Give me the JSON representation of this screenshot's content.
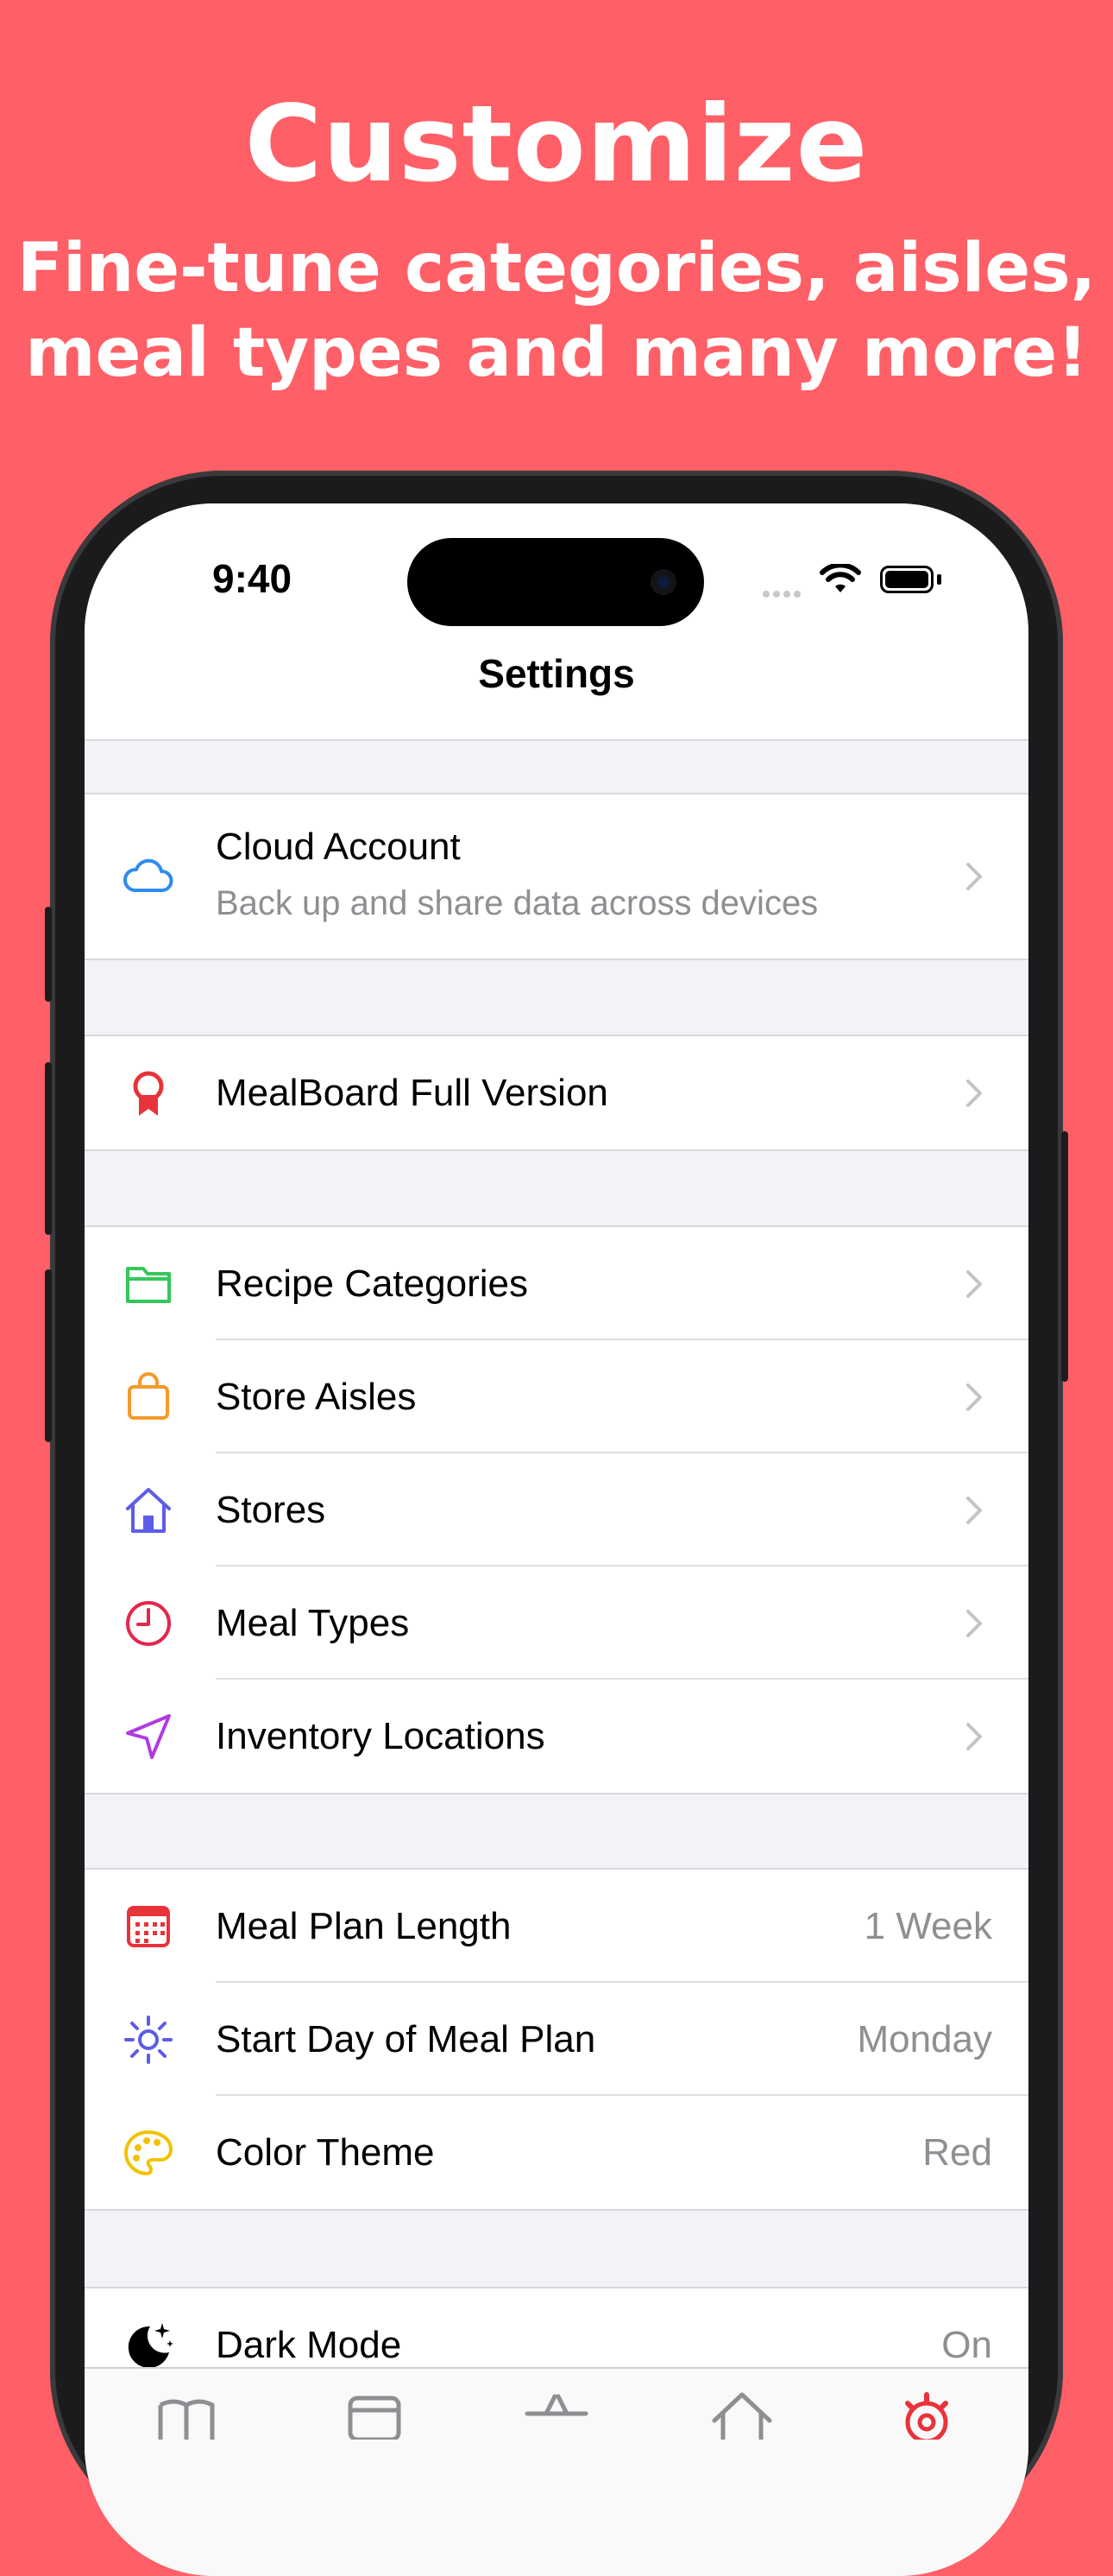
{
  "promo": {
    "headline": "Customize",
    "subhead_line1": "Fine-tune categories, aisles,",
    "subhead_line2": "meal types and many more!"
  },
  "status_bar": {
    "time": "9:40"
  },
  "nav": {
    "title": "Settings"
  },
  "sections": {
    "account": {
      "cloud": {
        "label": "Cloud Account",
        "subtitle": "Back up and share data across devices",
        "icon": "cloud-icon"
      }
    },
    "upgrade": {
      "full_version": {
        "label": "MealBoard Full Version",
        "icon": "ribbon-icon"
      }
    },
    "customize": {
      "recipe_categories": {
        "label": "Recipe Categories",
        "icon": "folder-icon"
      },
      "store_aisles": {
        "label": "Store Aisles",
        "icon": "bag-icon"
      },
      "stores": {
        "label": "Stores",
        "icon": "house-icon"
      },
      "meal_types": {
        "label": "Meal Types",
        "icon": "clock-icon"
      },
      "inventory_locations": {
        "label": "Inventory Locations",
        "icon": "location-arrow-icon"
      }
    },
    "plan": {
      "meal_plan_length": {
        "label": "Meal Plan Length",
        "value": "1 Week",
        "icon": "calendar-icon"
      },
      "start_day": {
        "label": "Start Day of Meal Plan",
        "value": "Monday",
        "icon": "sun-icon"
      },
      "color_theme": {
        "label": "Color Theme",
        "value": "Red",
        "icon": "palette-icon"
      }
    },
    "appearance": {
      "dark_mode": {
        "label": "Dark Mode",
        "value": "On",
        "icon": "moon-stars-icon"
      }
    }
  },
  "colors": {
    "background": "#FF5F66",
    "accent_red": "#E8333A",
    "cloud_blue": "#2F8CF0",
    "folder_green": "#34C759",
    "bag_orange": "#F39A2C",
    "house_indigo": "#5E5CE6",
    "clock_pink": "#E3264E",
    "arrow_purple": "#B03BE0",
    "palette_yellow": "#F2C200"
  }
}
